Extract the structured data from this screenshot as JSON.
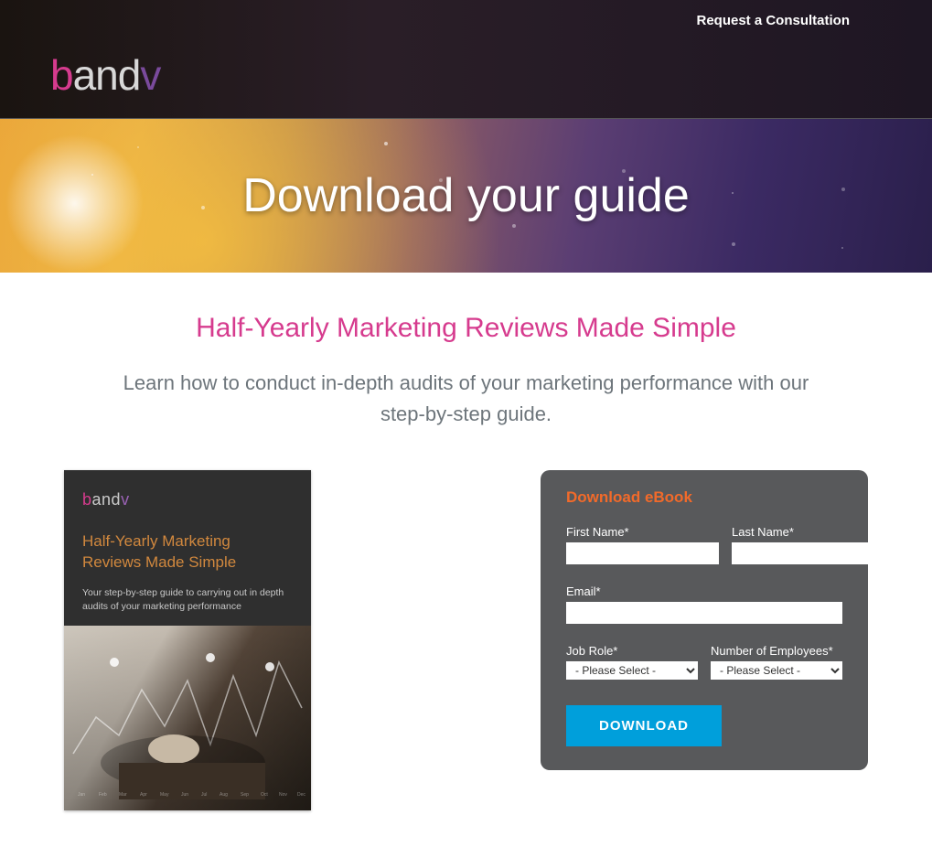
{
  "header": {
    "consultation_link": "Request a Consultation",
    "logo_parts": {
      "b": "b",
      "and": "and",
      "v": "v"
    }
  },
  "hero": {
    "title": "Download your guide"
  },
  "main": {
    "heading": "Half-Yearly Marketing Reviews Made Simple",
    "subheading": "Learn how to conduct in-depth audits of your marketing performance with our step-by-step guide."
  },
  "cover": {
    "logo_parts": {
      "b": "b",
      "and": "and",
      "v": "v"
    },
    "title": "Half-Yearly Marketing Reviews Made Simple",
    "subtitle": "Your step-by-step guide to carrying out in depth audits of your marketing performance"
  },
  "form": {
    "title": "Download eBook",
    "first_name_label": "First Name*",
    "last_name_label": "Last Name*",
    "email_label": "Email*",
    "job_role_label": "Job Role*",
    "employees_label": "Number of Employees*",
    "select_placeholder": "- Please Select -",
    "submit_label": "DOWNLOAD"
  }
}
